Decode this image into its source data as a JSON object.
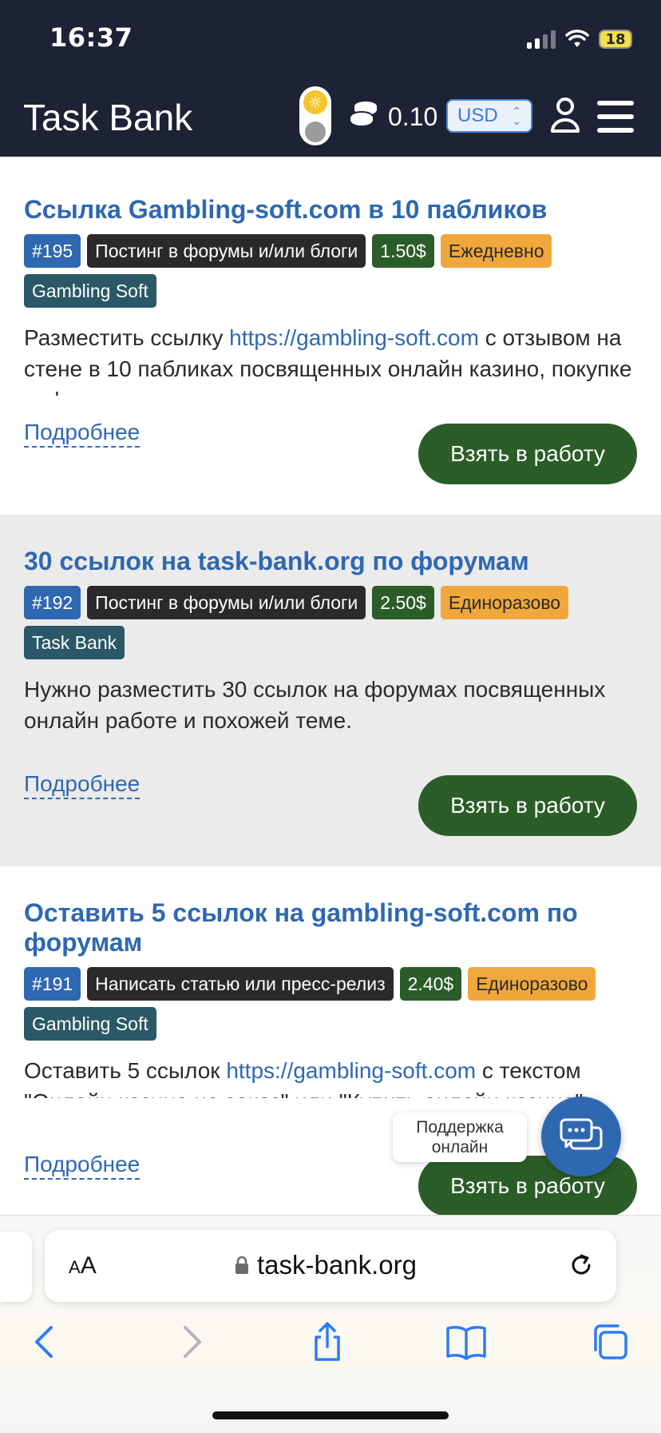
{
  "status_bar": {
    "time": "16:37",
    "battery": "18"
  },
  "header": {
    "logo": "Task Bank",
    "balance": "0.10",
    "currency": "USD",
    "icons": [
      "theme-toggle-icon",
      "coins-icon",
      "user-icon",
      "menu-icon"
    ]
  },
  "tasks": [
    {
      "title": "Ссылка Gambling-soft.com в 10 пабликов",
      "badges": {
        "id": "#195",
        "category": "Постинг в форумы и/или блоги",
        "price": "1.50$",
        "frequency": "Ежедневно",
        "site": "Gambling Soft"
      },
      "desc_before": "Разместить ссылку ",
      "desc_link": "https://gambling-soft.com",
      "desc_after": " с отзывом на стене  в 10 пабликах посвященных онлайн казино, покупке софта для казино",
      "more": "Подробнее",
      "take": "Взять в работу"
    },
    {
      "title": "30 ссылок на task-bank.org по форумам",
      "badges": {
        "id": "#192",
        "category": "Постинг в форумы и/или блоги",
        "price": "2.50$",
        "frequency": "Единоразово",
        "site": "Task Bank"
      },
      "desc_before": "Нужно разместить 30 ссылок на форумах посвященных онлайн работе и похожей теме.",
      "desc_link": "",
      "desc_after": "",
      "more": "Подробнее",
      "take": "Взять в работу"
    },
    {
      "title": "Оставить 5 ссылок на gambling-soft.com по форумам",
      "badges": {
        "id": "#191",
        "category": "Написать статью или пресс-релиз",
        "price": "2.40$",
        "frequency": "Единоразово",
        "site": "Gambling Soft"
      },
      "desc_before": "Оставить 5 ссылок ",
      "desc_link": "https://gambling-soft.com",
      "desc_after": " с текстом \"Онлайн казино на заказ\" или \"Купить онлайн казино\"",
      "more": "Подробнее",
      "take": "Взять в работу"
    }
  ],
  "support": {
    "label": "Поддержка онлайн"
  },
  "browser": {
    "aa": "AA",
    "url": "task-bank.org"
  },
  "colors": {
    "header_bg": "#1e2235",
    "link": "#2f68b1",
    "button": "#2b5d28",
    "frequency": "#f0a73b",
    "site": "#2a5866"
  }
}
